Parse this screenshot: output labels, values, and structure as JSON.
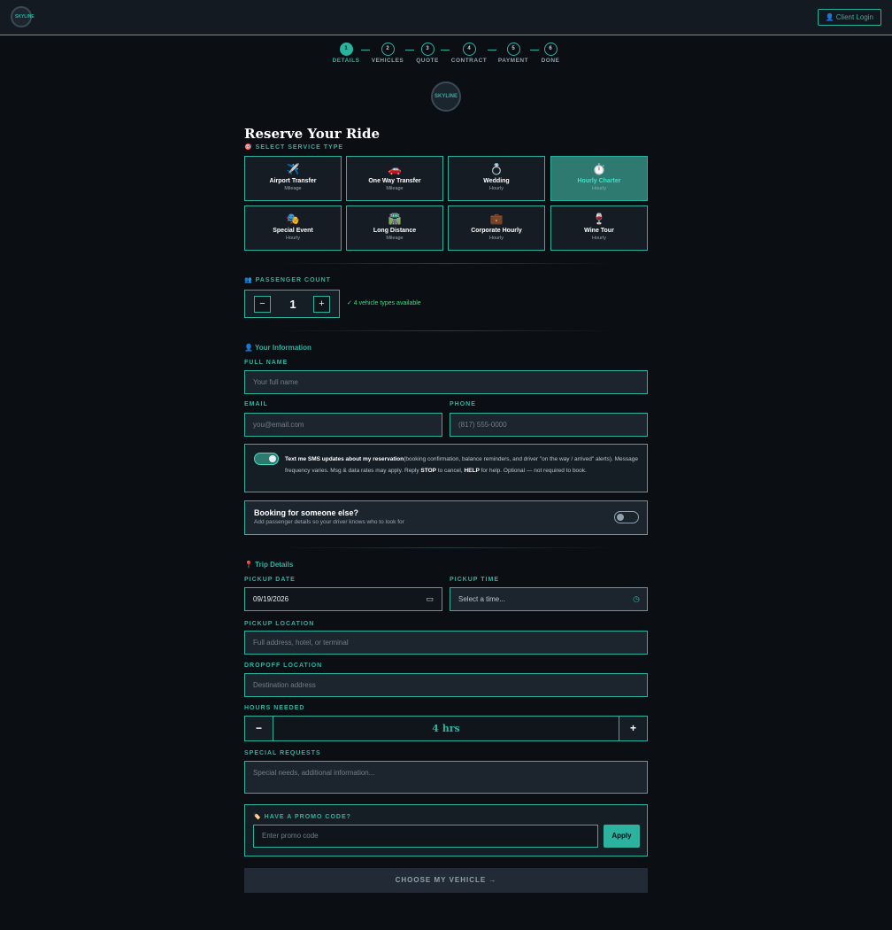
{
  "header": {
    "logo_text": "SKYLINE",
    "client_login": "👤 Client Login"
  },
  "steps": [
    {
      "num": "1",
      "label": "DETAILS"
    },
    {
      "num": "2",
      "label": "VEHICLES"
    },
    {
      "num": "3",
      "label": "QUOTE"
    },
    {
      "num": "4",
      "label": "CONTRACT"
    },
    {
      "num": "5",
      "label": "PAYMENT"
    },
    {
      "num": "6",
      "label": "DONE"
    }
  ],
  "brand": {
    "logo_text": "SKYLINE"
  },
  "form": {
    "title": "Reserve Your Ride",
    "service_label": "🎯 SELECT SERVICE TYPE",
    "services": [
      {
        "icon": "✈️",
        "name": "Airport Transfer",
        "sub": "Mileage"
      },
      {
        "icon": "🚗",
        "name": "One Way Transfer",
        "sub": "Mileage"
      },
      {
        "icon": "💍",
        "name": "Wedding",
        "sub": "Hourly"
      },
      {
        "icon": "⏱️",
        "name": "Hourly Charter",
        "sub": "Hourly"
      },
      {
        "icon": "🎭",
        "name": "Special Event",
        "sub": "Hourly"
      },
      {
        "icon": "🛣️",
        "name": "Long Distance",
        "sub": "Mileage"
      },
      {
        "icon": "💼",
        "name": "Corporate Hourly",
        "sub": "Hourly"
      },
      {
        "icon": "🍷",
        "name": "Wine Tour",
        "sub": "Hourly"
      }
    ],
    "selected_service": "Hourly Charter",
    "passenger": {
      "label": "👥 PASSENGER COUNT",
      "minus": "−",
      "plus": "+",
      "value": "1",
      "availability": "✓ 4 vehicle types available"
    },
    "your_info": {
      "heading": "👤 Your Information",
      "full_name_label": "FULL NAME",
      "full_name_placeholder": "Your full name",
      "email_label": "EMAIL",
      "email_placeholder": "you@email.com",
      "phone_label": "PHONE",
      "phone_placeholder": "(817) 555-0000"
    },
    "sms": {
      "bold": "Text me SMS updates about my reservation",
      "text1": "(booking confirmation, balance reminders, and driver \"on the way / arrived\" alerts). Message frequency varies. Msg & data rates may apply. Reply ",
      "stop": "STOP",
      "text2": " to cancel, ",
      "help": "HELP",
      "text3": " for help. Optional — not required to book.",
      "enabled": true
    },
    "someone_else": {
      "title": "Booking for someone else?",
      "sub": "Add passenger details so your driver knows who to look for",
      "enabled": false
    },
    "trip": {
      "heading": "📍 Trip Details",
      "pickup_date_label": "PICKUP DATE",
      "pickup_date_value": "09/19/2026",
      "pickup_time_label": "PICKUP TIME",
      "pickup_time_placeholder": "Select a time...",
      "pickup_location_label": "PICKUP LOCATION",
      "pickup_location_placeholder": "Full address, hotel, or terminal",
      "dropoff_label": "DROPOFF LOCATION",
      "dropoff_placeholder": "Destination address",
      "hours_label": "HOURS NEEDED",
      "hours_minus": "−",
      "hours_plus": "+",
      "hours_value": "4 hrs",
      "requests_label": "SPECIAL REQUESTS",
      "requests_placeholder": "Special needs, additional information..."
    },
    "promo": {
      "label": "🏷️ HAVE A PROMO CODE?",
      "placeholder": "Enter promo code",
      "apply": "Apply"
    },
    "cta": "CHOOSE MY VEHICLE →"
  },
  "colors": {
    "accent": "#2bb3a0",
    "background": "#0b0f14",
    "panel": "#161e25",
    "success": "#3ddc84"
  }
}
